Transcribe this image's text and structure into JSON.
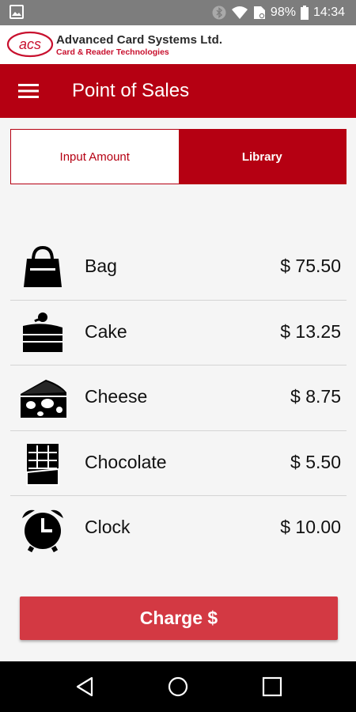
{
  "status_bar": {
    "battery": "98%",
    "time": "14:34",
    "icons": [
      "gallery-icon",
      "bluetooth-icon",
      "wifi-icon",
      "document-icon",
      "battery-icon"
    ]
  },
  "brand": {
    "logo_text": "acs",
    "company": "Advanced Card Systems Ltd.",
    "tagline": "Card & Reader Technologies"
  },
  "app_bar": {
    "title": "Point of Sales",
    "menu_icon": "hamburger-menu-icon"
  },
  "tabs": [
    {
      "label": "Input Amount",
      "active": false
    },
    {
      "label": "Library",
      "active": true
    }
  ],
  "items": [
    {
      "name": "Bag",
      "price": "$ 75.50",
      "icon": "bag-icon"
    },
    {
      "name": "Cake",
      "price": "$ 13.25",
      "icon": "cake-icon"
    },
    {
      "name": "Cheese",
      "price": "$ 8.75",
      "icon": "cheese-icon"
    },
    {
      "name": "Chocolate",
      "price": "$ 5.50",
      "icon": "chocolate-icon"
    },
    {
      "name": "Clock",
      "price": "$ 10.00",
      "icon": "alarm-clock-icon"
    }
  ],
  "charge_button": {
    "label": "Charge $"
  },
  "nav_bar": [
    "back-icon",
    "home-icon",
    "recents-icon"
  ],
  "colors": {
    "primary": "#b50012",
    "charge_button": "#d33943",
    "status_bar": "#7d7d7d",
    "logo_red": "#c8102e"
  }
}
